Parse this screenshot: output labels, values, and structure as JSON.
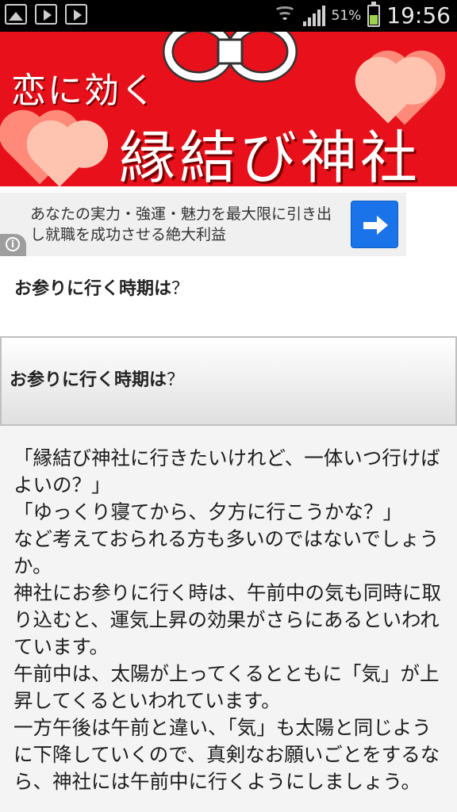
{
  "status_bar": {
    "notification_icons": [
      "gallery-icon",
      "play-store-icon",
      "play-store-icon"
    ],
    "battery_percent": "51%",
    "battery_level": 0.51,
    "time": "19:56"
  },
  "banner": {
    "subtitle": "恋に効く",
    "title": "縁結び神社",
    "background_color": "#e8101a"
  },
  "ad": {
    "text": "あなたの実力・強運・魅力を最大限に引き出し就職を成功させる絶大利益",
    "arrow_icon": "arrow-right-icon",
    "info_icon": "info-icon"
  },
  "section_heading": {
    "text": "お参りに行く時期は",
    "suffix": "？"
  },
  "panel": {
    "heading": "お参りに行く時期は",
    "suffix": "？",
    "paragraphs": [
      "「縁結び神社に行きたいけれど、一体いつ行けばよいの？」",
      "「ゆっくり寝てから、夕方に行こうかな？」",
      "など考えておられる方も多いのではないでしょうか。",
      "神社にお参りに行く時は、午前中の気も同時に取り込むと、運気上昇の効果がさらにあるといわれています。",
      "午前中は、太陽が上ってくるとともに「気」が上昇してくるといわれています。",
      "一方午後は午前と違い、「気」も太陽と同じように下降していくので、真剣なお願いごとをするなら、神社には午前中に行くようにしましょう。"
    ]
  }
}
